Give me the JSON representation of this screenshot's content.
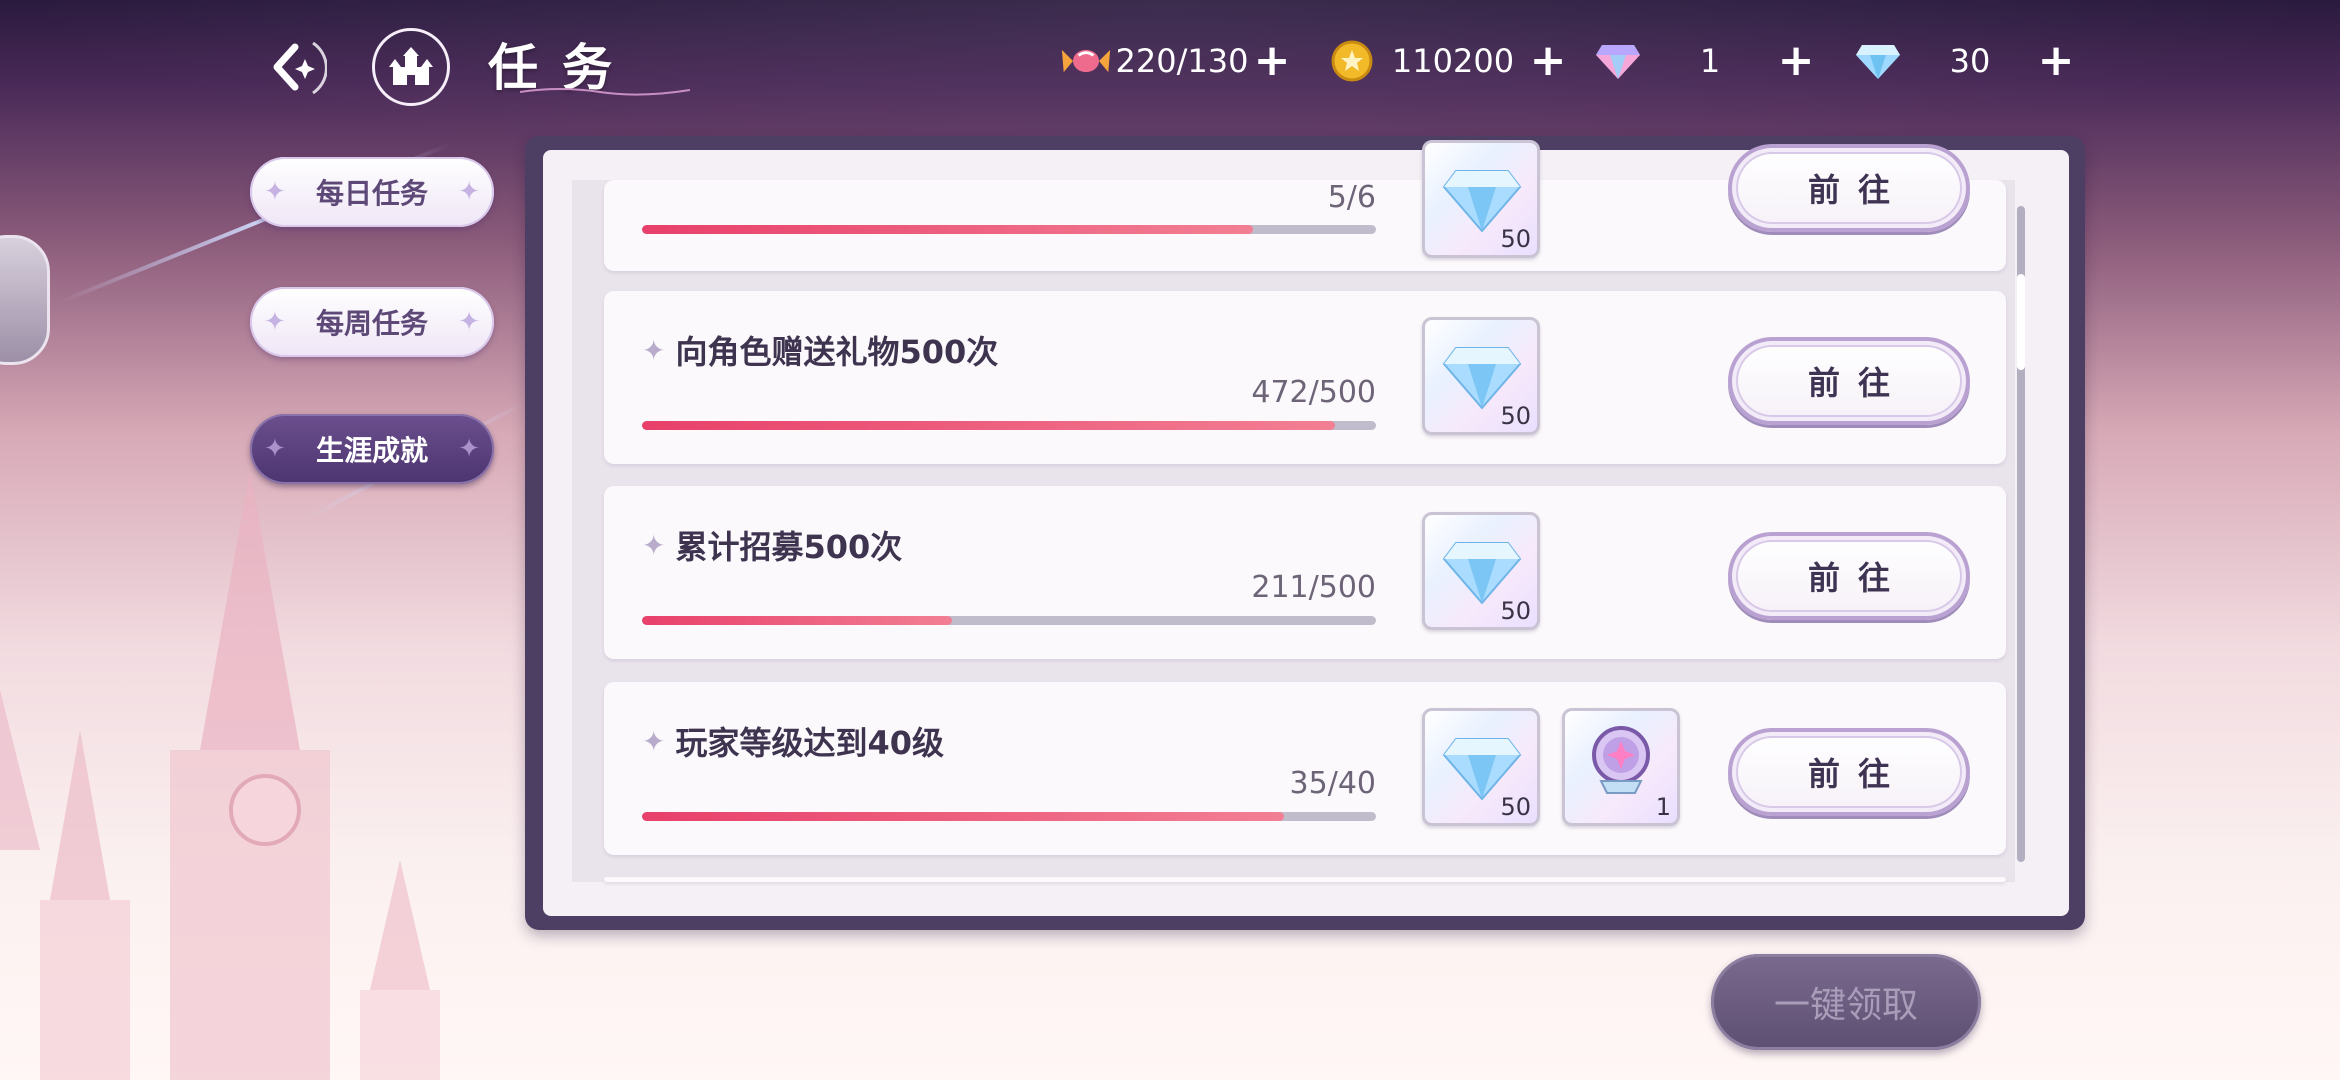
{
  "header": {
    "title": "任务",
    "resources": [
      {
        "icon": "candy-icon",
        "value": "220/130",
        "plus": "+"
      },
      {
        "icon": "gold-coin-icon",
        "value": "110200",
        "plus": "+"
      },
      {
        "icon": "pink-diamond-icon",
        "value": "1",
        "plus": "+"
      },
      {
        "icon": "blue-diamond-icon",
        "value": "30",
        "plus": "+"
      }
    ]
  },
  "tabs": [
    {
      "label": "每日任务",
      "active": false
    },
    {
      "label": "每周任务",
      "active": false
    },
    {
      "label": "生涯成就",
      "active": true
    }
  ],
  "tasks": [
    {
      "title": "",
      "progress": "5/6",
      "fraction": 0.833,
      "rewards": [
        {
          "icon": "diamond-icon",
          "qty": "50"
        }
      ],
      "button": "前往"
    },
    {
      "title": "向角色赠送礼物500次",
      "progress": "472/500",
      "fraction": 0.944,
      "rewards": [
        {
          "icon": "diamond-icon",
          "qty": "50"
        }
      ],
      "button": "前往"
    },
    {
      "title": "累计招募500次",
      "progress": "211/500",
      "fraction": 0.422,
      "rewards": [
        {
          "icon": "diamond-icon",
          "qty": "50"
        }
      ],
      "button": "前往"
    },
    {
      "title": "玩家等级达到40级",
      "progress": "35/40",
      "fraction": 0.875,
      "rewards": [
        {
          "icon": "diamond-icon",
          "qty": "50"
        },
        {
          "icon": "crystal-ball-icon",
          "qty": "1"
        }
      ],
      "button": "前往"
    }
  ],
  "claim_all": "一键领取",
  "colors": {
    "accent": "#e8406a",
    "panel": "#4d3e63",
    "tab_active": "#5a4280"
  }
}
